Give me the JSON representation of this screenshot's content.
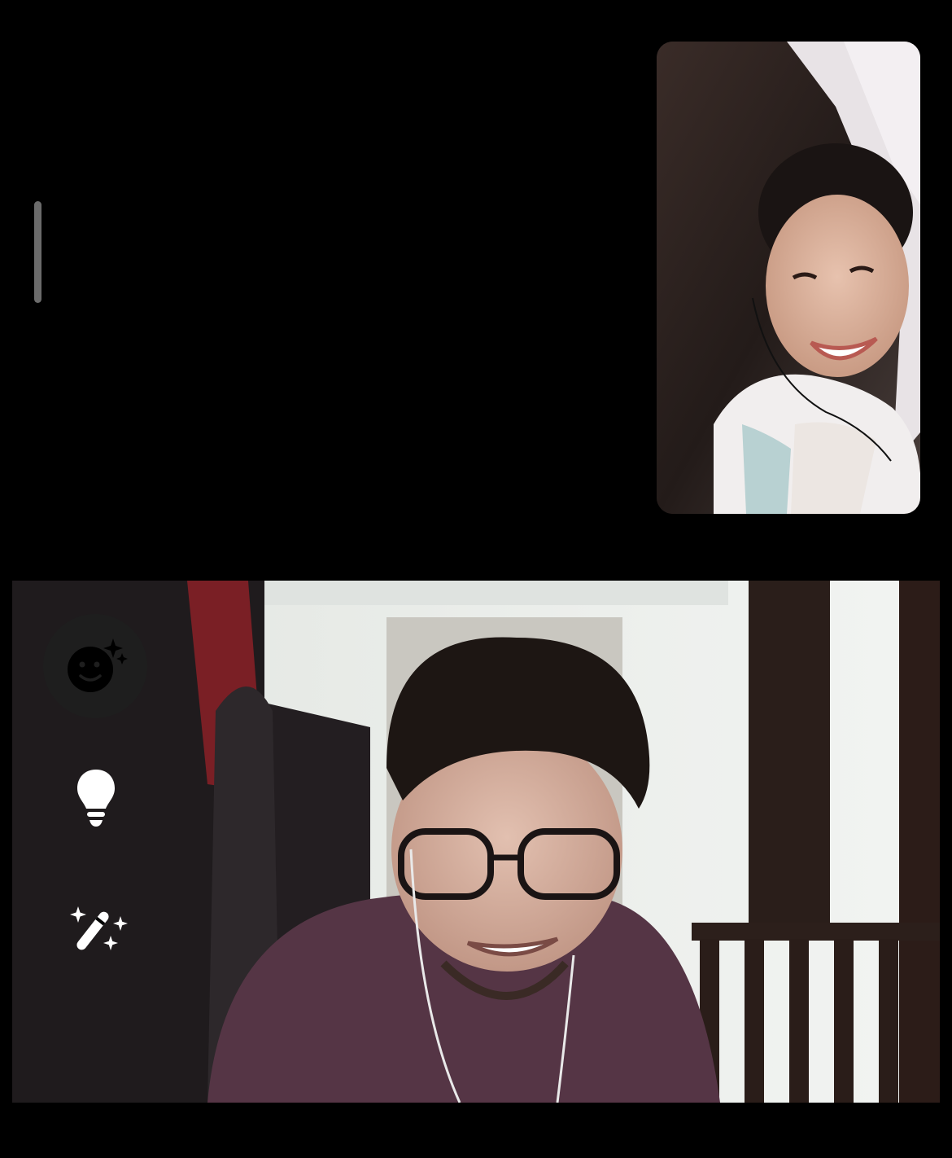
{
  "call": {
    "remote_participant": {
      "icon": "remote-video-feed"
    },
    "self_preview": {
      "icon": "self-video-feed"
    },
    "controls": [
      {
        "id": "face-effects",
        "icon": "face-sparkle-icon"
      },
      {
        "id": "low-light",
        "icon": "lightbulb-icon"
      },
      {
        "id": "magic-effects",
        "icon": "magic-wand-icon"
      }
    ]
  },
  "colors": {
    "background": "#000000",
    "control_bg": "#1e1e1e",
    "icon_fg": "#ffffff",
    "indicator": "#6b6b6b"
  }
}
